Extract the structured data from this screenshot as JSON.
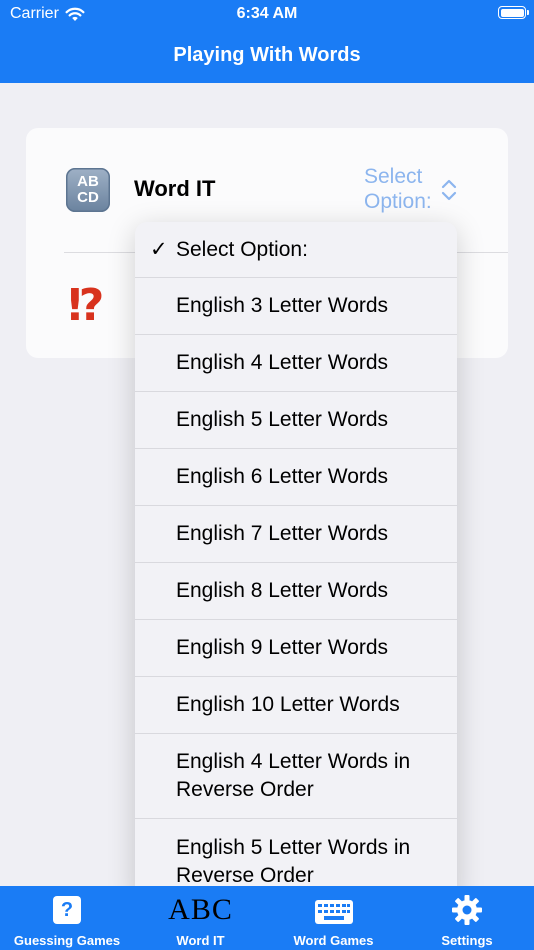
{
  "status_bar": {
    "carrier": "Carrier",
    "time": "6:34 AM"
  },
  "nav_bar": {
    "title": "Playing With Words"
  },
  "card": {
    "row1": {
      "icon_text_top": "AB",
      "icon_text_bottom": "CD",
      "label": "Word IT",
      "select_line1": "Select",
      "select_line2": "Option:"
    },
    "row2": {
      "icon_glyph": "⁉"
    }
  },
  "menu": {
    "items": [
      {
        "label": "Select Option:",
        "checked": true
      },
      {
        "label": "English 3 Letter Words"
      },
      {
        "label": "English 4 Letter Words"
      },
      {
        "label": "English 5 Letter Words"
      },
      {
        "label": "English 6 Letter Words"
      },
      {
        "label": "English 7 Letter Words"
      },
      {
        "label": "English 8 Letter Words"
      },
      {
        "label": "English 9 Letter Words"
      },
      {
        "label": "English 10 Letter Words"
      },
      {
        "label": "English 4 Letter Words in Reverse Order"
      },
      {
        "label": "English 5 Letter Words in Reverse Order"
      }
    ],
    "check_glyph": "✓"
  },
  "tab_bar": {
    "tabs": [
      {
        "label": "Guessing Games",
        "icon_text": "?"
      },
      {
        "label": "Word IT",
        "icon_text": "ABC"
      },
      {
        "label": "Word Games"
      },
      {
        "label": "Settings"
      }
    ]
  },
  "colors": {
    "accent": "#1a7cf5",
    "select_text": "#8cb5ee",
    "interrobang": "#d8321d"
  }
}
